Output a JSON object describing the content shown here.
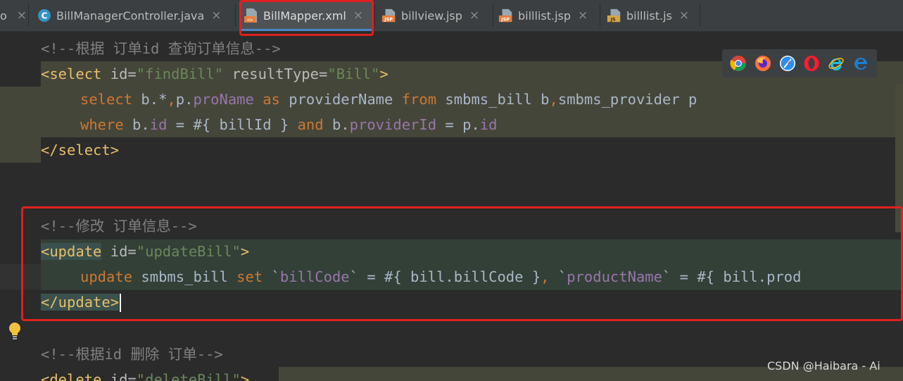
{
  "tabs": [
    {
      "name": "o",
      "label": "o",
      "icon": "none",
      "active": false
    },
    {
      "name": "billmanagercontroller",
      "label": "BillManagerController.java",
      "icon": "java-class-icon",
      "active": false
    },
    {
      "name": "billmapper",
      "label": "BillMapper.xml",
      "icon": "xml-file-icon",
      "active": true
    },
    {
      "name": "billview",
      "label": "billview.jsp",
      "icon": "jsp-file-icon",
      "active": false
    },
    {
      "name": "billlist-jsp",
      "label": "billlist.jsp",
      "icon": "jsp-file-icon",
      "active": false
    },
    {
      "name": "billlist-js",
      "label": "billlist.js",
      "icon": "js-file-icon",
      "active": false
    }
  ],
  "close_glyph": "×",
  "icon_badges": {
    "class": "C",
    "jsp": "JSP",
    "js": "JS",
    "xml": "<>"
  },
  "code": {
    "l1": "<!--根据 订单id 查询订单信息-->",
    "l2_open": "<select",
    "l2_id_attr": " id=",
    "l2_id_val": "\"findBill\"",
    "l2_rt_attr": " resultType=",
    "l2_rt_val": "\"Bill\"",
    "l2_close": ">",
    "l3_a": "select",
    "l3_b": " b.*",
    "l3_c": ",",
    "l3_d": "p.",
    "l3_e": "proName",
    "l3_f": " as",
    "l3_g": " providerName ",
    "l3_h": "from",
    "l3_i": " smbms_bill b",
    "l3_j": ",",
    "l3_k": "smbms_provider p",
    "l4_a": "where",
    "l4_b": " b.",
    "l4_c": "id",
    "l4_d": " = #{ billId } ",
    "l4_e": "and",
    "l4_f": " b.",
    "l4_g": "providerId",
    "l4_h": " = p.",
    "l4_i": "id",
    "l5": "</select>",
    "l6": "<!--修改 订单信息-->",
    "l7_open": "<update",
    "l7_id_attr": " id=",
    "l7_id_val": "\"updateBill\"",
    "l7_close": ">",
    "l8_a": "update",
    "l8_b": " smbms_bill ",
    "l8_c": "set",
    "l8_d": " `",
    "l8_e": "billCode",
    "l8_f": "` = #{ bill.billCode }",
    "l8_g": ",",
    "l8_h": " `",
    "l8_i": "productName",
    "l8_j": "` = #{ bill.prod",
    "l9": "</update>",
    "l10": "<!--根据id 删除 订单-->",
    "l11_open": "<delete",
    "l11_id_attr": " id=",
    "l11_id_val": "\"deleteBill\"",
    "l11_close": ">"
  },
  "browser_icons": [
    "chrome-icon",
    "firefox-icon",
    "safari-icon",
    "opera-icon",
    "ie-icon",
    "edge-icon"
  ],
  "watermark": "CSDN @Haibara - Ai",
  "colors": {
    "highlight_box": "#e02020",
    "tab_underline": "#4a88c7"
  }
}
